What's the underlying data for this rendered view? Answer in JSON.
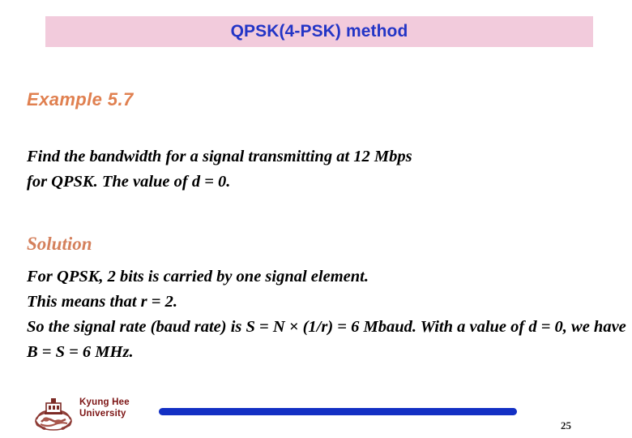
{
  "slide": {
    "title": "QPSK(4-PSK) method",
    "title_banner_color": "#f2cbdc",
    "title_text_color": "#2335c6"
  },
  "example": {
    "heading": "Example 5.7",
    "heading_color": "#e08050",
    "question_line_1": "Find the bandwidth for a signal transmitting at 12 Mbps",
    "question_line_2": "for QPSK. The value of d = 0."
  },
  "solution": {
    "heading": "Solution",
    "heading_color": "#d4805c",
    "line_1": "For QPSK, 2 bits is carried by one signal element.",
    "line_2": "This means that r = 2.",
    "line_3": "So the signal rate (baud rate) is S = N × (1/r) = 6 Mbaud. With a value of d = 0,  we have B = S = 6 MHz."
  },
  "footer": {
    "logo_icon": "kyung-hee-crest-icon",
    "university_line_1": "Kyung Hee",
    "university_line_2": "University",
    "university_color": "#7c1414",
    "bar_color": "#1330c4",
    "page_number": "25"
  }
}
